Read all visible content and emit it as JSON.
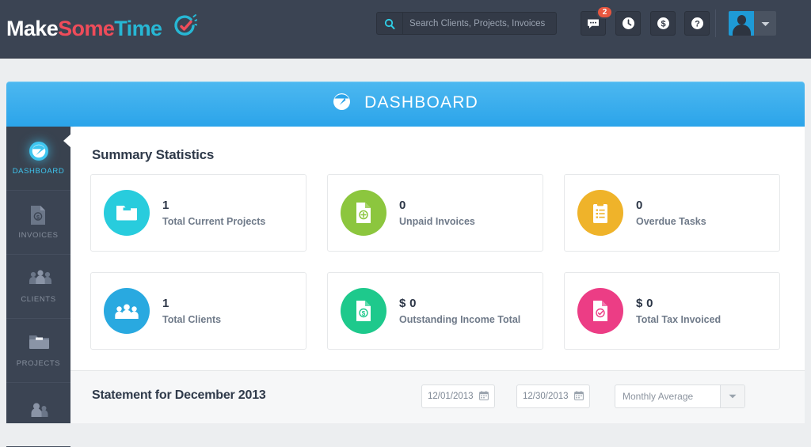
{
  "brand": {
    "name_part1": "Make",
    "name_part2": "Some",
    "name_part3": "Time",
    "logo_icon": "clock-check-icon",
    "color_white": "#ffffff",
    "color_red": "#ef4c5a",
    "color_cyan": "#27b7d4"
  },
  "topbar": {
    "search": {
      "placeholder": "Search Clients, Projects, Invoices",
      "value": "",
      "icon": "search-icon"
    },
    "actions": [
      {
        "name": "messages-button",
        "icon": "chat-icon",
        "badge": "2"
      },
      {
        "name": "time-tracking-button",
        "icon": "clock-icon",
        "badge": ""
      },
      {
        "name": "billing-button",
        "icon": "dollar-icon",
        "badge": ""
      },
      {
        "name": "help-button",
        "icon": "question-icon",
        "badge": ""
      }
    ],
    "badge_color": "#e8563f",
    "account": {
      "icon": "avatar-icon",
      "caret": "chevron-down-icon"
    }
  },
  "page": {
    "title": "DASHBOARD",
    "title_icon": "speedometer-icon",
    "header_color": "#2ba4ea"
  },
  "sidebar": {
    "items": [
      {
        "label": "DASHBOARD",
        "icon": "speedometer-icon",
        "active": true
      },
      {
        "label": "INVOICES",
        "icon": "invoice-document-icon",
        "active": false
      },
      {
        "label": "CLIENTS",
        "icon": "clients-group-icon",
        "active": false
      },
      {
        "label": "PROJECTS",
        "icon": "folder-icon",
        "active": false
      },
      {
        "label": "",
        "icon": "team-icon",
        "active": false
      }
    ],
    "active_color": "#3ec6f0"
  },
  "main": {
    "summary_title": "Summary Statistics",
    "cards": [
      {
        "value": "1",
        "label": "Total Current Projects",
        "icon": "folder-icon",
        "color": "#28ccdd"
      },
      {
        "value": "0",
        "label": "Unpaid Invoices",
        "icon": "document-plus-icon",
        "color": "#8cc63e"
      },
      {
        "value": "0",
        "label": "Overdue Tasks",
        "icon": "clipboard-list-icon",
        "color": "#efb32a"
      },
      {
        "value": "1",
        "label": "Total Clients",
        "icon": "clients-group-icon",
        "color": "#29a9e0"
      },
      {
        "value": "$ 0",
        "label": "Outstanding Income Total",
        "icon": "document-dollar-icon",
        "color": "#1ec98c"
      },
      {
        "value": "$ 0",
        "label": "Total Tax Invoiced",
        "icon": "document-check-icon",
        "color": "#ec3d85"
      }
    ],
    "statement": {
      "title": "Statement for December 2013",
      "date_from": "12/01/2013",
      "date_to": "12/30/2013",
      "range_separator": "–",
      "date_icon": "calendar-icon",
      "period_selected": "Monthly Average",
      "period_caret": "chevron-down-icon"
    }
  }
}
